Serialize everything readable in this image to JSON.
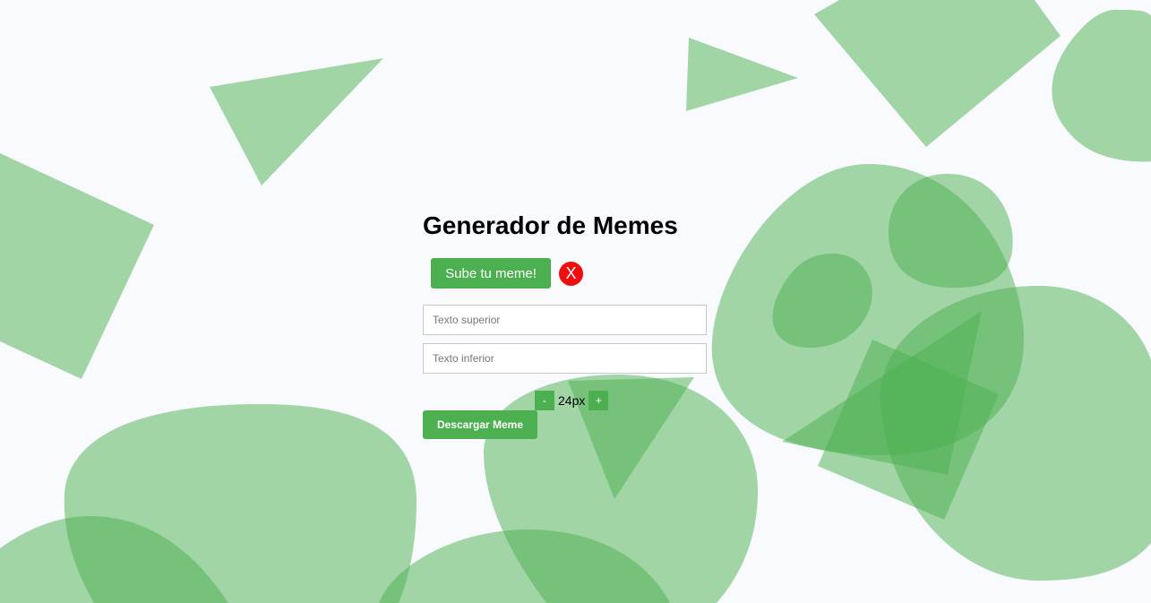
{
  "page": {
    "title": "Generador de Memes"
  },
  "upload": {
    "button_label": "Sube tu meme!",
    "clear_label": "X"
  },
  "inputs": {
    "top_text": {
      "value": "",
      "placeholder": "Texto superior"
    },
    "bottom_text": {
      "value": "",
      "placeholder": "Texto inferior"
    }
  },
  "font_size": {
    "decrease_label": "-",
    "value": "24px",
    "increase_label": "+"
  },
  "download": {
    "button_label": "Descargar Meme"
  },
  "colors": {
    "accent": "#4caf50",
    "danger": "#f00d0d",
    "background": "#f8fafd"
  }
}
